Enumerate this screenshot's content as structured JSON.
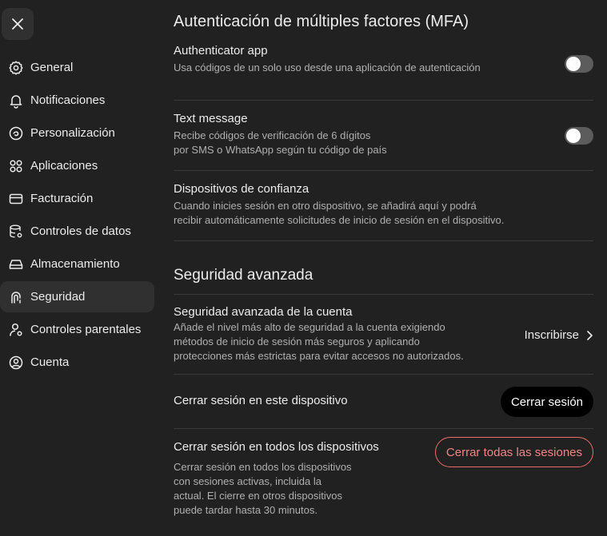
{
  "sidebar": {
    "close_icon": "close-icon",
    "items": [
      {
        "label": "General",
        "icon": "gear-icon"
      },
      {
        "label": "Notificaciones",
        "icon": "bell-icon"
      },
      {
        "label": "Personalización",
        "icon": "personalize-icon"
      },
      {
        "label": "Aplicaciones",
        "icon": "apps-grid-icon"
      },
      {
        "label": "Facturación",
        "icon": "credit-card-icon"
      },
      {
        "label": "Controles de datos",
        "icon": "database-settings-icon"
      },
      {
        "label": "Almacenamiento",
        "icon": "storage-drive-icon"
      },
      {
        "label": "Seguridad",
        "icon": "security-icon",
        "active": true
      },
      {
        "label": "Controles parentales",
        "icon": "parental-user-icon"
      },
      {
        "label": "Cuenta",
        "icon": "account-icon"
      }
    ]
  },
  "mfa": {
    "title": "Autenticación de múltiples factores (MFA)",
    "authenticator": {
      "title": "Authenticator app",
      "desc": "Usa códigos de un solo uso desde una aplicación de autenticación",
      "enabled": false
    },
    "sms": {
      "title": "Text message",
      "desc_line1": "Recibe códigos de verificación de 6 dígitos",
      "desc_line2": "por SMS o WhatsApp según tu código de país",
      "enabled": false
    },
    "trusted": {
      "title": "Dispositivos de confianza",
      "desc_line1": "Cuando inicies sesión en otro dispositivo, se añadirá aquí y podrá",
      "desc_line2": "recibir automáticamente solicitudes de inicio de sesión en el dispositivo."
    }
  },
  "advanced": {
    "title": "Seguridad avanzada",
    "account": {
      "title": "Seguridad avanzada de la cuenta",
      "desc_line1": "Añade el nivel más alto de seguridad a la cuenta exigiendo",
      "desc_line2": "métodos de inicio de sesión más seguros y aplicando",
      "desc_line3": "protecciones más estrictas para evitar accesos no autorizados.",
      "action": "Inscribirse"
    },
    "logout_this": {
      "title": "Cerrar sesión en este dispositivo",
      "action": "Cerrar sesión"
    },
    "logout_all": {
      "title": "Cerrar sesión en todos los dispositivos",
      "desc_line1": "Cerrar sesión en todos los dispositivos",
      "desc_line2": "con sesiones activas, incluida la",
      "desc_line3": "actual. El cierre en otros dispositivos",
      "desc_line4": "puede tardar hasta 30 minutos.",
      "action": "Cerrar todas las sesiones"
    }
  },
  "colors": {
    "background": "#212121",
    "active_item": "#303030",
    "danger": "#ef6b6b"
  }
}
